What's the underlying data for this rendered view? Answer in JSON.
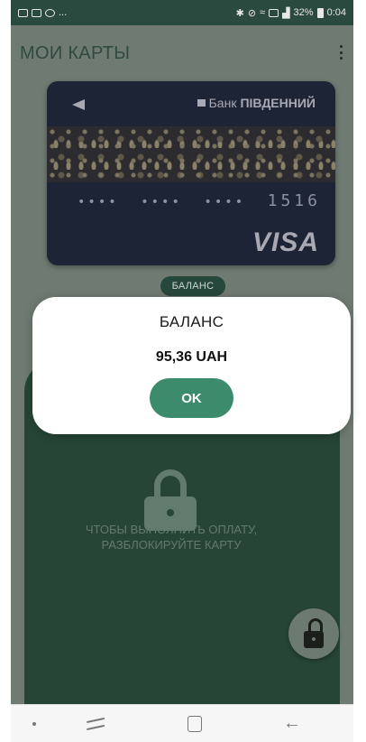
{
  "status_bar": {
    "left_icons": [
      "image-icon",
      "gallery-icon",
      "whatsapp-icon"
    ],
    "overflow": "...",
    "right_icons": [
      "bluetooth-icon",
      "mute-icon",
      "wifi-icon",
      "nfc-icon",
      "signal-icon"
    ],
    "battery": "32%",
    "time": "0:04"
  },
  "header": {
    "title": "МОИ КАРТЫ",
    "menu_icon": "more-vert-icon"
  },
  "card": {
    "bank_name_prefix": "Банк",
    "bank_name": "ПІВДЕННИЙ",
    "masked_groups": [
      "••••",
      "••••",
      "••••"
    ],
    "last_digits": "1516",
    "brand": "VISA"
  },
  "balance_chip": {
    "label": "БАЛАНС"
  },
  "payment_panel": {
    "hint_line1": "ЧТОБЫ ВЫПОЛНИТЬ ОПЛАТУ,",
    "hint_line2": "РАЗБЛОКИРУЙТЕ КАРТУ",
    "lock_icon": "lock-icon",
    "unlock_icon": "unlock-icon"
  },
  "dialog": {
    "title": "БАЛАНС",
    "value": "95,36 UAH",
    "ok_label": "OK"
  },
  "colors": {
    "accent": "#3c8b6d",
    "panel": "#264536",
    "card": "#1d2435"
  }
}
